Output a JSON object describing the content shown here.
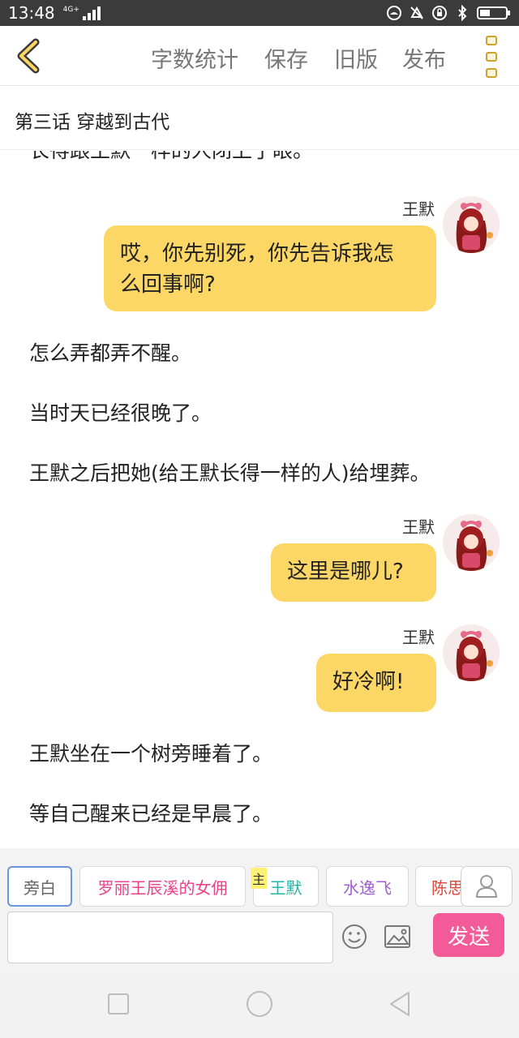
{
  "status_bar": {
    "time": "13:48",
    "network": "4G+"
  },
  "toolbar": {
    "word_count": "字数统计",
    "save": "保存",
    "old_version": "旧版",
    "publish": "发布",
    "accent_color": "#c9a32c"
  },
  "chapter": {
    "title": "第三话  穿越到古代"
  },
  "story": {
    "clipped_line": "长得跟王默一样的人闭上了眼。",
    "narration": [
      "怎么弄都弄不醒。",
      "当时天已经很晚了。",
      "王默之后把她(给王默长得一样的人)给埋葬。",
      "王默坐在一个树旁睡着了。",
      "等自己醒来已经是早晨了。"
    ],
    "dialogues": [
      {
        "speaker": "王默",
        "line1": "哎，你先别死，你先告诉我怎",
        "line2": "么回事啊?"
      },
      {
        "speaker": "王默",
        "text": "这里是哪儿?"
      },
      {
        "speaker": "王默",
        "text": "好冷啊!"
      }
    ],
    "bubble_color": "#fcd765"
  },
  "characters": {
    "main_badge": "主",
    "items": [
      {
        "label": "旁白",
        "color": "#666666"
      },
      {
        "label": "罗丽王辰溪的女佣",
        "color": "#e8438a"
      },
      {
        "label": "王默",
        "color": "#23b5a6"
      },
      {
        "label": "水逸飞",
        "color": "#a05fd0"
      },
      {
        "label": "陈思",
        "color": "#e0453a"
      }
    ]
  },
  "input": {
    "value": "",
    "send": "发送",
    "send_color": "#f35b98"
  }
}
